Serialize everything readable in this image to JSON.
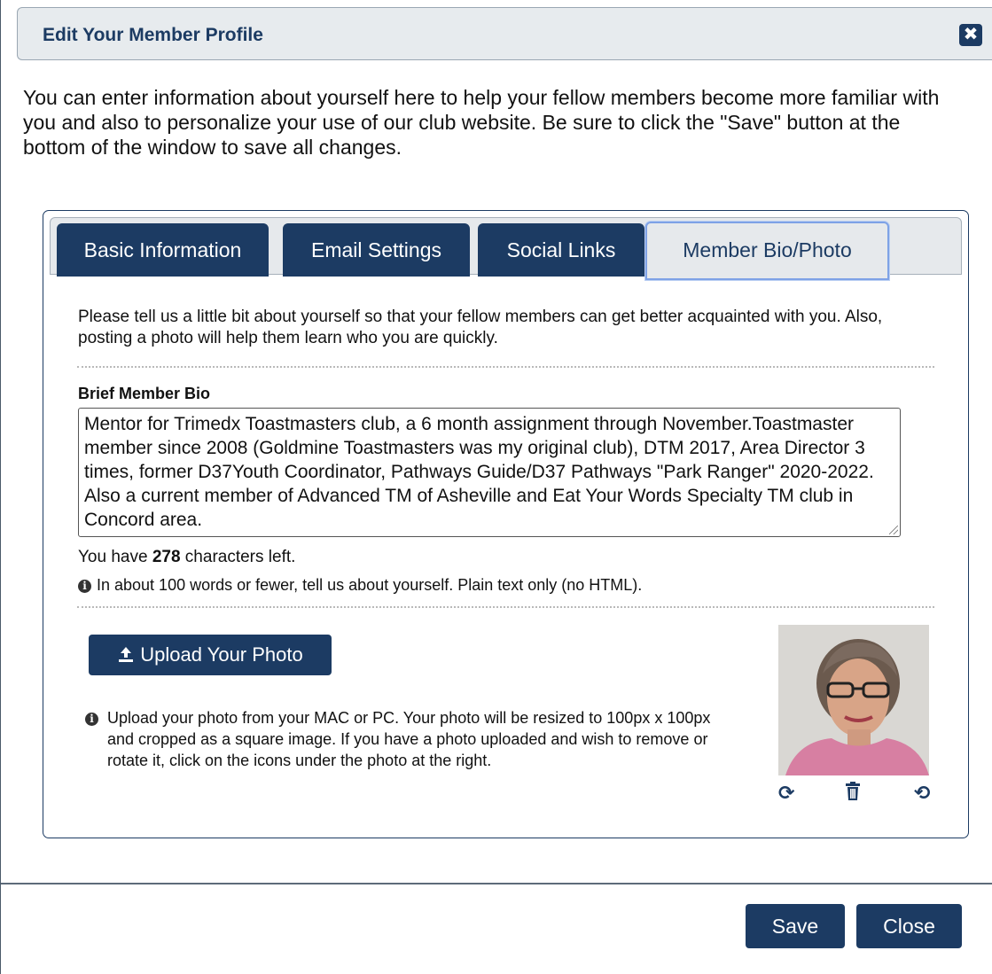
{
  "dialog": {
    "title": "Edit Your Member Profile",
    "close_symbol": "✖",
    "intro": "You can enter information about yourself here to help your fellow members become more familiar with you and also to personalize your use of our club website. Be sure to click the \"Save\" button at the bottom of the window to save all changes."
  },
  "tabs": [
    {
      "label": "Basic Information",
      "active": false
    },
    {
      "label": "Email Settings",
      "active": false
    },
    {
      "label": "Social Links",
      "active": false
    },
    {
      "label": "Member Bio/Photo",
      "active": true
    }
  ],
  "bio": {
    "intro": "Please tell us a little bit about yourself so that your fellow members can get better acquainted with you. Also, posting a photo will help them learn who you are quickly.",
    "label": "Brief Member Bio",
    "value": "Mentor for  Trimedx Toastmasters club, a 6 month assignment through November.Toastmaster member since 2008 (Goldmine Toastmasters was my original club), DTM 2017, Area Director 3 times,  former D37Youth Coordinator, Pathways Guide/D37 Pathways \"Park Ranger\" 2020-2022. Also a current member of Advanced TM of Asheville and Eat Your Words Specialty TM club in Concord area.",
    "chars_prefix": "You have ",
    "chars_left": "278",
    "chars_suffix": " characters left.",
    "hint": "In about 100 words or fewer, tell us about yourself. Plain text only (no HTML)."
  },
  "photo": {
    "upload_label": "Upload Your Photo",
    "upload_icon": "upload-icon",
    "description": "Upload your photo from your MAC or PC. Your photo will be resized to 100px x 100px and cropped as a square image. If you have a photo uploaded and wish to remove or rotate it, click on the icons under the photo at the right.",
    "actions": [
      "rotate-clockwise-icon",
      "trash-icon",
      "rotate-counterclockwise-icon"
    ]
  },
  "footer": {
    "save_label": "Save",
    "close_label": "Close"
  },
  "colors": {
    "brand": "#1c3b63",
    "tab_bar": "#e6e9ec",
    "active_tab_outline": "#7ea2e6"
  }
}
